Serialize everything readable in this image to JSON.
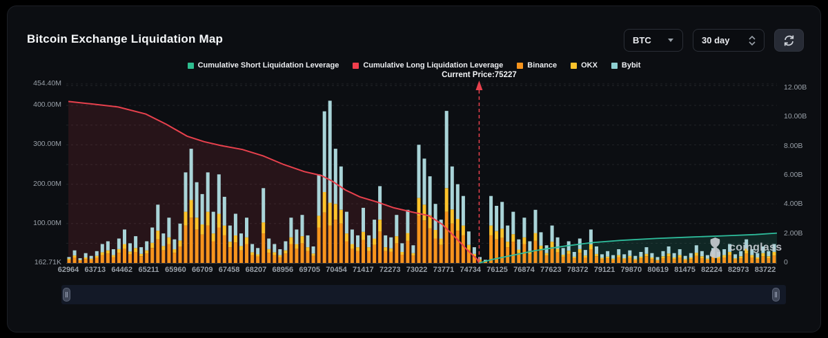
{
  "header": {
    "title": "Bitcoin Exchange Liquidation Map"
  },
  "controls": {
    "symbol_select": {
      "value": "BTC",
      "icon": "caret-down"
    },
    "period_select": {
      "value": "30 day",
      "icon": "spinner-chevrons"
    },
    "refresh_button": {
      "icon": "refresh"
    }
  },
  "watermark": {
    "text": "coinglass",
    "icon": "coinglass-logo"
  },
  "colors": {
    "short_line": "#2ebd9c",
    "long_line": "#e8414d",
    "binance": "#f7941d",
    "okx": "#fdc32b",
    "bybit": "#a9d4d8",
    "bybit_legend": "#8ecfd1",
    "long_legend": "#f23f4d",
    "short_legend": "#2ebd8f",
    "grid": "rgba(255,255,255,0.09)",
    "axis_text": "#9aa1a9"
  },
  "chart_data": {
    "type": "bar",
    "subtype": "stacked bars (left axis, USD) + cumulative leverage lines (right axis)",
    "title": "Bitcoin Exchange Liquidation Map",
    "legend": [
      {
        "label": "Cumulative Short Liquidation Leverage",
        "color": "#2ebd8f",
        "kind": "line"
      },
      {
        "label": "Cumulative Long Liquidation Leverage",
        "color": "#f23f4d",
        "kind": "line"
      },
      {
        "label": "Binance",
        "color": "#f7941d",
        "kind": "bar"
      },
      {
        "label": "OKX",
        "color": "#fdc32b",
        "kind": "bar"
      },
      {
        "label": "Bybit",
        "color": "#8ecfd1",
        "kind": "bar"
      }
    ],
    "current_price": {
      "label": "Current Price:75227",
      "value": 75227,
      "x_frac": 0.581
    },
    "x_axis": {
      "labels": [
        "62964",
        "63713",
        "64462",
        "65211",
        "65960",
        "66709",
        "67458",
        "68207",
        "68956",
        "69705",
        "70454",
        "71417",
        "72273",
        "73022",
        "73771",
        "74734",
        "76125",
        "76874",
        "77623",
        "78372",
        "79121",
        "79870",
        "80619",
        "81475",
        "82224",
        "82973",
        "83722"
      ]
    },
    "y_axis_left": {
      "units": "M",
      "max_value": 454.4,
      "ticks": [
        {
          "label": "454.40M",
          "value": 454.4
        },
        {
          "label": "400.00M",
          "value": 400
        },
        {
          "label": "300.00M",
          "value": 300
        },
        {
          "label": "200.00M",
          "value": 200
        },
        {
          "label": "100.00M",
          "value": 100
        },
        {
          "label": "162.71K",
          "value": 0.16
        }
      ]
    },
    "y_axis_right": {
      "units": "B",
      "max_value": 12,
      "ticks": [
        {
          "label": "12.00B",
          "value": 12
        },
        {
          "label": "10.00B",
          "value": 10
        },
        {
          "label": "8.00B",
          "value": 8
        },
        {
          "label": "6.00B",
          "value": 6
        },
        {
          "label": "4.00B",
          "value": 4
        },
        {
          "label": "2.00B",
          "value": 2
        },
        {
          "label": "0",
          "value": 0
        }
      ]
    },
    "series": {
      "stack_order": [
        "Binance",
        "OKX",
        "Bybit"
      ],
      "bars_M": [
        [
          8,
          3,
          4
        ],
        [
          14,
          5,
          13
        ],
        [
          6,
          2,
          4
        ],
        [
          10,
          4,
          11
        ],
        [
          8,
          3,
          7
        ],
        [
          13,
          5,
          12
        ],
        [
          20,
          7,
          21
        ],
        [
          24,
          8,
          23
        ],
        [
          15,
          5,
          15
        ],
        [
          26,
          9,
          27
        ],
        [
          36,
          12,
          37
        ],
        [
          22,
          7,
          21
        ],
        [
          28,
          10,
          30
        ],
        [
          17,
          6,
          17
        ],
        [
          24,
          8,
          23
        ],
        [
          38,
          13,
          39
        ],
        [
          60,
          22,
          66
        ],
        [
          32,
          11,
          32
        ],
        [
          48,
          17,
          50
        ],
        [
          26,
          9,
          25
        ],
        [
          42,
          15,
          43
        ],
        [
          95,
          35,
          100
        ],
        [
          115,
          45,
          130
        ],
        [
          85,
          30,
          90
        ],
        [
          72,
          26,
          77
        ],
        [
          95,
          35,
          100
        ],
        [
          55,
          20,
          55
        ],
        [
          90,
          35,
          100
        ],
        [
          70,
          25,
          73
        ],
        [
          40,
          14,
          41
        ],
        [
          52,
          18,
          55
        ],
        [
          32,
          11,
          32
        ],
        [
          48,
          17,
          50
        ],
        [
          20,
          7,
          21
        ],
        [
          16,
          6,
          16
        ],
        [
          75,
          28,
          87
        ],
        [
          26,
          9,
          27
        ],
        [
          20,
          7,
          21
        ],
        [
          15,
          5,
          15
        ],
        [
          24,
          8,
          23
        ],
        [
          48,
          17,
          50
        ],
        [
          36,
          12,
          37
        ],
        [
          50,
          18,
          54
        ],
        [
          30,
          10,
          30
        ],
        [
          18,
          6,
          18
        ],
        [
          90,
          30,
          105
        ],
        [
          128,
          52,
          205
        ],
        [
          95,
          58,
          259
        ],
        [
          110,
          40,
          140
        ],
        [
          100,
          35,
          110
        ],
        [
          55,
          20,
          55
        ],
        [
          36,
          12,
          37
        ],
        [
          30,
          10,
          30
        ],
        [
          58,
          21,
          61
        ],
        [
          30,
          10,
          30
        ],
        [
          46,
          16,
          48
        ],
        [
          80,
          30,
          85
        ],
        [
          30,
          10,
          30
        ],
        [
          28,
          9,
          28
        ],
        [
          50,
          18,
          54
        ],
        [
          21,
          7,
          22
        ],
        [
          56,
          20,
          59
        ],
        [
          19,
          6,
          20
        ],
        [
          120,
          45,
          135
        ],
        [
          108,
          40,
          117
        ],
        [
          88,
          33,
          99
        ],
        [
          62,
          22,
          66
        ],
        [
          46,
          16,
          48
        ],
        [
          130,
          60,
          196
        ],
        [
          100,
          36,
          109
        ],
        [
          82,
          30,
          88
        ],
        [
          70,
          25,
          75
        ],
        [
          34,
          12,
          34
        ],
        [
          17,
          6,
          17
        ],
        [
          7,
          2,
          6
        ],
        [
          4,
          1,
          3
        ],
        [
          70,
          25,
          75
        ],
        [
          60,
          21,
          64
        ],
        [
          64,
          23,
          68
        ],
        [
          40,
          14,
          41
        ],
        [
          54,
          19,
          57
        ],
        [
          25,
          9,
          26
        ],
        [
          48,
          17,
          50
        ],
        [
          23,
          8,
          24
        ],
        [
          56,
          20,
          59
        ],
        [
          32,
          12,
          34
        ],
        [
          19,
          6,
          20
        ],
        [
          40,
          14,
          41
        ],
        [
          27,
          9,
          29
        ],
        [
          16,
          5,
          17
        ],
        [
          23,
          8,
          24
        ],
        [
          12,
          4,
          12
        ],
        [
          26,
          9,
          27
        ],
        [
          14,
          5,
          14
        ],
        [
          35,
          12,
          38
        ],
        [
          17,
          6,
          19
        ],
        [
          10,
          3,
          9
        ],
        [
          12,
          4,
          14
        ],
        [
          8,
          3,
          9
        ],
        [
          15,
          5,
          15
        ],
        [
          9,
          3,
          10
        ],
        [
          13,
          5,
          14
        ],
        [
          7,
          3,
          8
        ],
        [
          12,
          4,
          12
        ],
        [
          17,
          6,
          17
        ],
        [
          10,
          4,
          11
        ],
        [
          6,
          2,
          7
        ],
        [
          12,
          5,
          13
        ],
        [
          17,
          7,
          18
        ],
        [
          10,
          4,
          11
        ],
        [
          14,
          6,
          15
        ],
        [
          7,
          3,
          8
        ],
        [
          10,
          4,
          11
        ],
        [
          18,
          8,
          19
        ],
        [
          12,
          5,
          13
        ],
        [
          8,
          3,
          9
        ],
        [
          16,
          6,
          16
        ],
        [
          11,
          5,
          12
        ],
        [
          14,
          6,
          15
        ],
        [
          20,
          8,
          20
        ],
        [
          9,
          3,
          10
        ],
        [
          12,
          5,
          13
        ],
        [
          24,
          12,
          24
        ],
        [
          14,
          6,
          15
        ],
        [
          10,
          4,
          11
        ],
        [
          17,
          8,
          17
        ],
        [
          12,
          5,
          13
        ],
        [
          19,
          9,
          20
        ]
      ],
      "long_line_M": [
        [
          0.003,
          410
        ],
        [
          0.034,
          404
        ],
        [
          0.073,
          396
        ],
        [
          0.112,
          378
        ],
        [
          0.141,
          352
        ],
        [
          0.17,
          322
        ],
        [
          0.194,
          308
        ],
        [
          0.218,
          298
        ],
        [
          0.248,
          288
        ],
        [
          0.277,
          272
        ],
        [
          0.306,
          250
        ],
        [
          0.335,
          232
        ],
        [
          0.359,
          222
        ],
        [
          0.374,
          208
        ],
        [
          0.393,
          185
        ],
        [
          0.413,
          168
        ],
        [
          0.437,
          155
        ],
        [
          0.461,
          140
        ],
        [
          0.485,
          130
        ],
        [
          0.51,
          120
        ],
        [
          0.529,
          98
        ],
        [
          0.549,
          62
        ],
        [
          0.566,
          30
        ],
        [
          0.578,
          10
        ],
        [
          0.581,
          0
        ]
      ],
      "short_line_B": [
        [
          0.581,
          0
        ],
        [
          0.6,
          0.25
        ],
        [
          0.63,
          0.55
        ],
        [
          0.66,
          0.85
        ],
        [
          0.7,
          1.15
        ],
        [
          0.74,
          1.4
        ],
        [
          0.78,
          1.55
        ],
        [
          0.83,
          1.68
        ],
        [
          0.88,
          1.78
        ],
        [
          0.93,
          1.87
        ],
        [
          0.97,
          1.95
        ],
        [
          1.0,
          2.05
        ]
      ]
    },
    "grid": "dashed horizontal gridlines",
    "legend_position": "top-center"
  }
}
